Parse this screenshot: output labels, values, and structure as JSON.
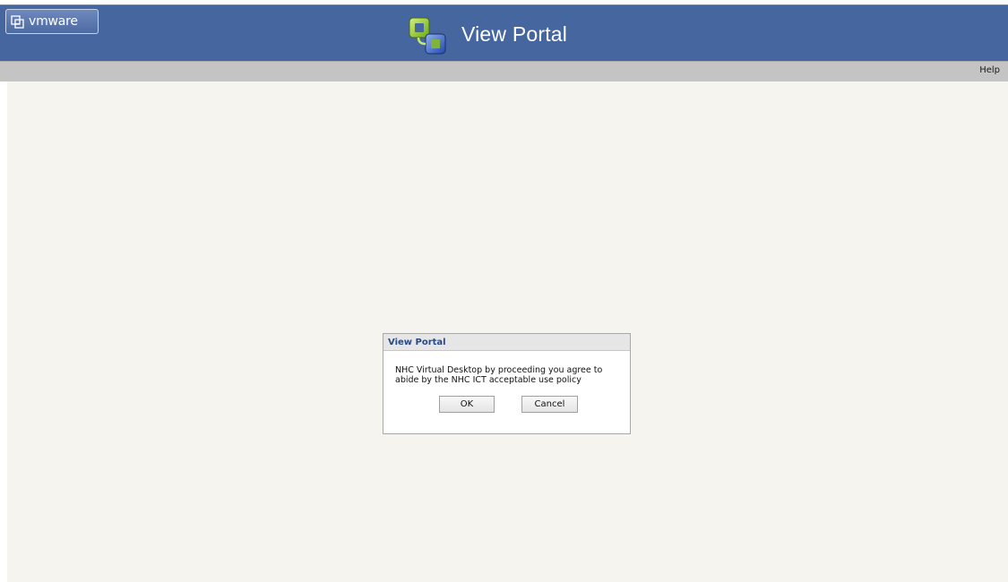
{
  "banner": {
    "logo_text": "vmware",
    "logo_icon": "vmware-logo-icon",
    "app_icon": "view-portal-icon",
    "title": "View Portal"
  },
  "toolbar": {
    "help_label": "Help"
  },
  "dialog": {
    "title": "View Portal",
    "message": "NHC Virtual Desktop by proceeding you agree to abide by the NHC ICT acceptable use policy",
    "ok_label": "OK",
    "cancel_label": "Cancel"
  },
  "colors": {
    "banner": "#4666a0",
    "toolbar": "#c4c4c4",
    "content_background": "#f5f4ee",
    "dialog_title_text": "#2a4a85"
  }
}
